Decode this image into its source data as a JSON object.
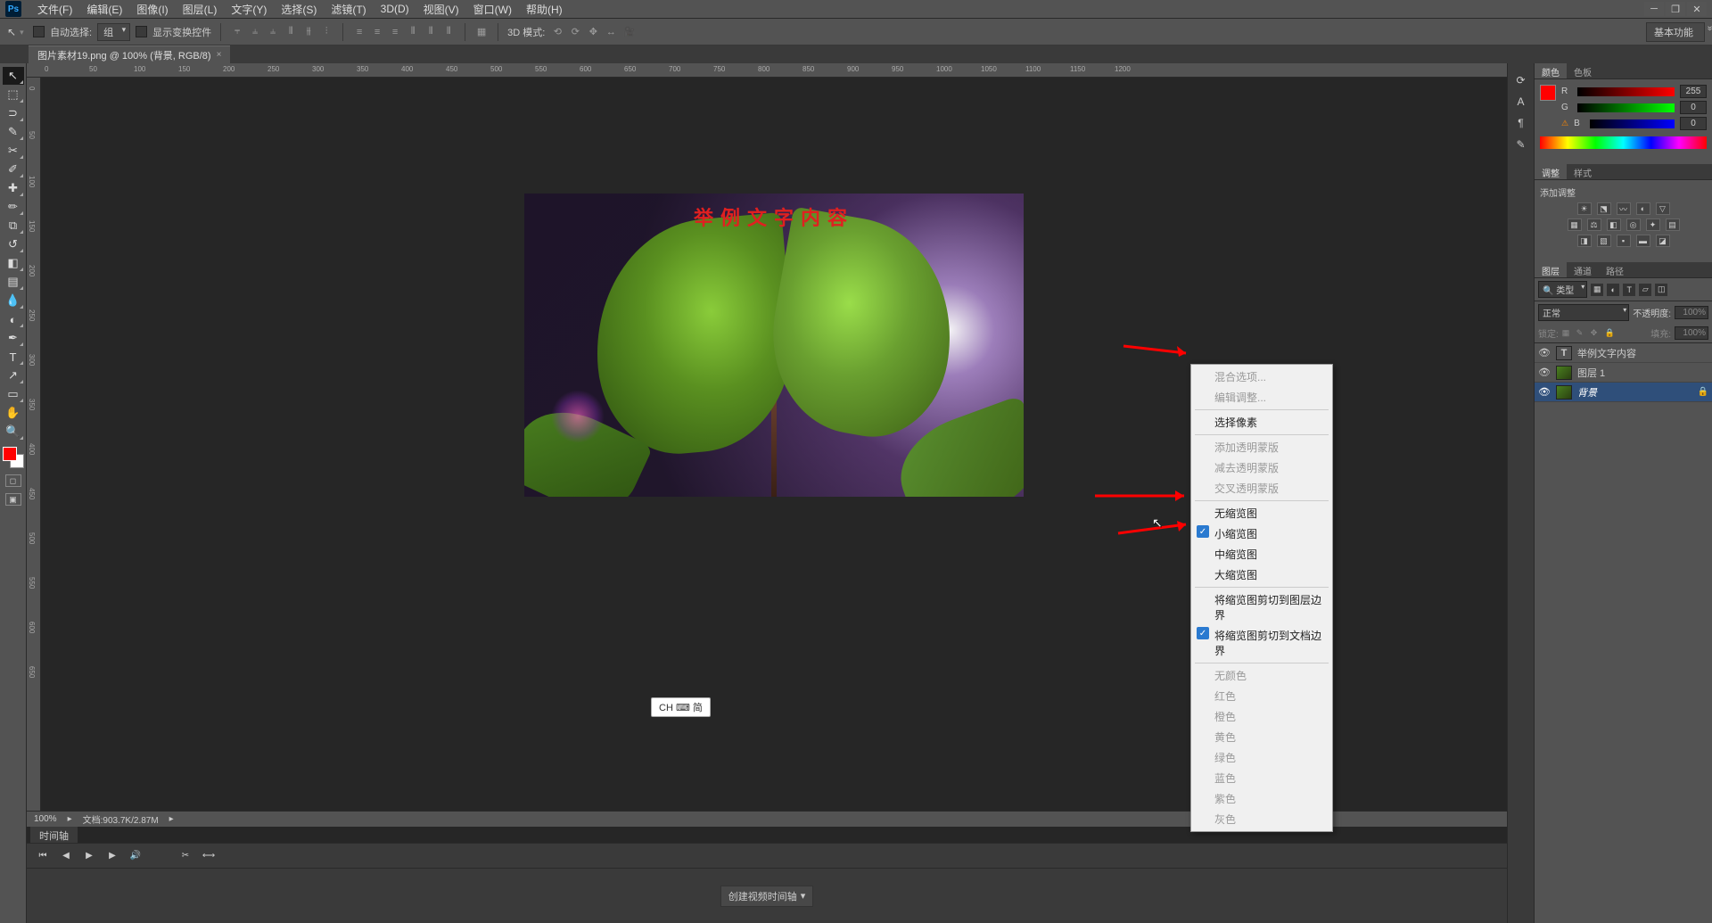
{
  "app": {
    "logo": "Ps"
  },
  "menu": {
    "file": "文件(F)",
    "edit": "编辑(E)",
    "image": "图像(I)",
    "layer": "图层(L)",
    "type": "文字(Y)",
    "select": "选择(S)",
    "filter": "滤镜(T)",
    "three_d": "3D(D)",
    "view": "视图(V)",
    "window": "窗口(W)",
    "help": "帮助(H)"
  },
  "options": {
    "auto_select": "自动选择:",
    "group": "组",
    "show_transform": "显示变换控件",
    "three_d_mode": "3D 模式:",
    "workspace": "基本功能"
  },
  "tab": {
    "title": "图片素材19.png @ 100% (背景, RGB/8)",
    "close": "×"
  },
  "canvas": {
    "overlay_text": "举例文字内容"
  },
  "status": {
    "zoom": "100%",
    "doc_info": "文档:903.7K/2.87M"
  },
  "timeline": {
    "tab": "时间轴",
    "create_btn": "创建视频时间轴"
  },
  "panels": {
    "color": {
      "tab_color": "颜色",
      "tab_swatch": "色板",
      "r": "R",
      "g": "G",
      "b": "B",
      "r_val": "255",
      "g_val": "0",
      "b_val": "0"
    },
    "adjust": {
      "tab_adjust": "调整",
      "tab_style": "样式",
      "add_label": "添加调整"
    },
    "layers": {
      "tab_layers": "图层",
      "tab_channels": "通道",
      "tab_paths": "路径",
      "filter_kind": "类型",
      "blend_normal": "正常",
      "opacity_label": "不透明度:",
      "opacity_val": "100%",
      "lock_label": "锁定:",
      "fill_label": "填充:",
      "fill_val": "100%",
      "items": [
        {
          "name": "举例文字内容",
          "type": "text"
        },
        {
          "name": "图层 1",
          "type": "image"
        },
        {
          "name": "背景",
          "type": "bg",
          "italic": true,
          "locked": true,
          "selected": true
        }
      ]
    }
  },
  "context_menu": {
    "items": [
      {
        "label": "混合选项...",
        "disabled": true
      },
      {
        "label": "编辑调整...",
        "disabled": true
      },
      {
        "sep": true
      },
      {
        "label": "选择像素"
      },
      {
        "sep": true
      },
      {
        "label": "添加透明蒙版",
        "disabled": true
      },
      {
        "label": "减去透明蒙版",
        "disabled": true
      },
      {
        "label": "交叉透明蒙版",
        "disabled": true
      },
      {
        "sep": true
      },
      {
        "label": "无缩览图"
      },
      {
        "label": "小缩览图",
        "checked": true
      },
      {
        "label": "中缩览图"
      },
      {
        "label": "大缩览图"
      },
      {
        "sep": true
      },
      {
        "label": "将缩览图剪切到图层边界"
      },
      {
        "label": "将缩览图剪切到文档边界",
        "checked": true
      },
      {
        "sep": true
      },
      {
        "label": "无颜色",
        "disabled": true
      },
      {
        "label": "红色",
        "disabled": true
      },
      {
        "label": "橙色",
        "disabled": true
      },
      {
        "label": "黄色",
        "disabled": true
      },
      {
        "label": "绿色",
        "disabled": true
      },
      {
        "label": "蓝色",
        "disabled": true
      },
      {
        "label": "紫色",
        "disabled": true
      },
      {
        "label": "灰色",
        "disabled": true
      }
    ]
  },
  "ime": {
    "label": "CH ⌨ 简"
  },
  "ruler_ticks_h": [
    "0",
    "50",
    "100",
    "150",
    "200",
    "250",
    "300",
    "350",
    "400",
    "450",
    "500",
    "550",
    "600",
    "650",
    "700",
    "750",
    "800",
    "850",
    "900",
    "950",
    "1000",
    "1050",
    "1100",
    "1150",
    "1200"
  ],
  "ruler_ticks_v": [
    "0",
    "50",
    "100",
    "150",
    "200",
    "250",
    "300",
    "350",
    "400",
    "450",
    "500",
    "550",
    "600",
    "650"
  ]
}
